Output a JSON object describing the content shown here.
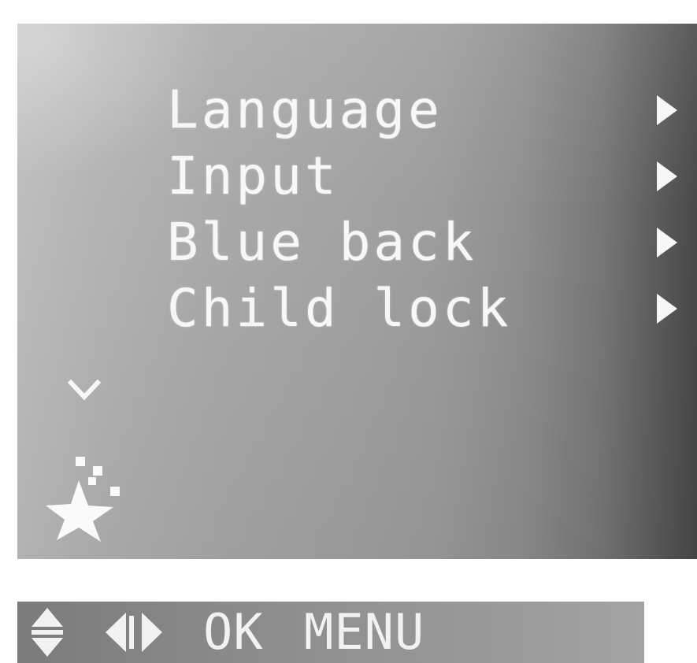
{
  "menu": {
    "items": [
      {
        "label": "Language",
        "arrow_icon": "triangle-right-icon"
      },
      {
        "label": "Input",
        "arrow_icon": "triangle-right-icon"
      },
      {
        "label": "Blue back",
        "arrow_icon": "triangle-right-icon"
      },
      {
        "label": "Child lock",
        "arrow_icon": "triangle-right-icon"
      }
    ],
    "more_indicator_icon": "chevron-down-icon",
    "category_icon": "star-icon"
  },
  "help_bar": {
    "updown_icon": "up-down-arrows-icon",
    "leftright_icon": "left-right-arrows-icon",
    "ok_label": "OK",
    "menu_label": "MENU"
  },
  "colors": {
    "text": "#f7f7f7",
    "panel_light": "#bdbdbd",
    "panel_dark": "#484848",
    "help_bar": "#8d8d8d"
  }
}
